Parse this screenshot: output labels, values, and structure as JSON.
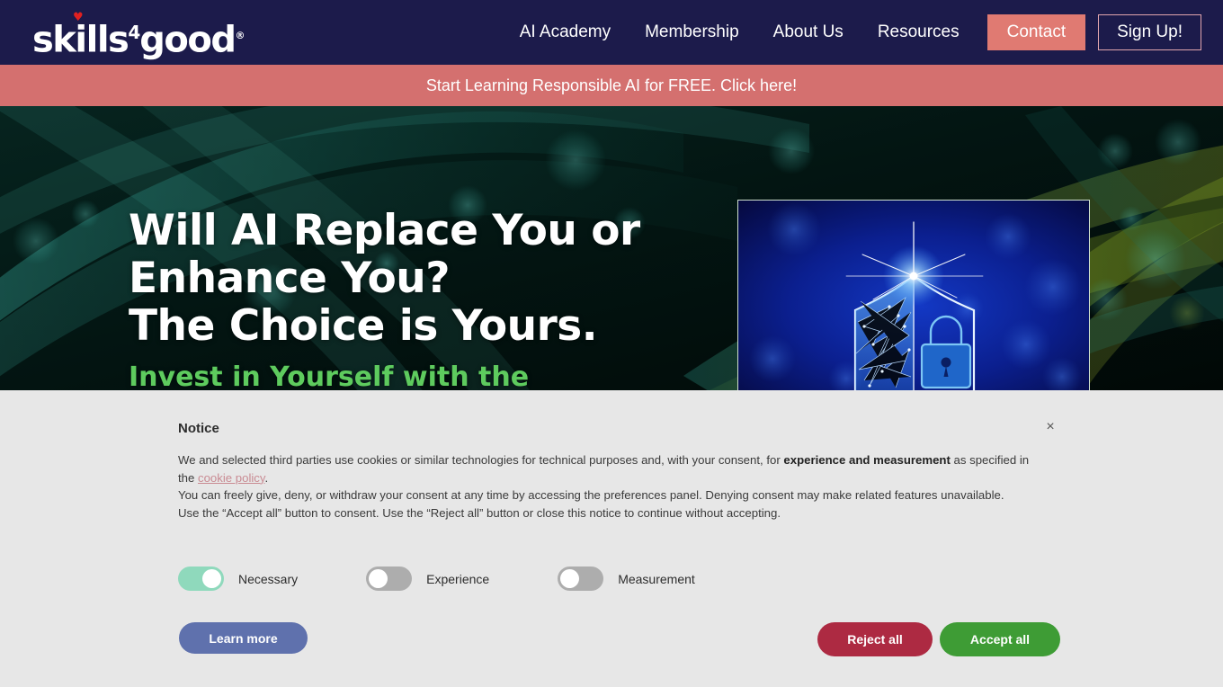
{
  "header": {
    "logo": {
      "text_before": "skills",
      "sup": "4",
      "text_after": "good",
      "registered": "®",
      "heart_icon": "heart-icon"
    },
    "nav": [
      {
        "label": "AI Academy",
        "name": "nav-link-ai-academy"
      },
      {
        "label": "Membership",
        "name": "nav-link-membership"
      },
      {
        "label": "About Us",
        "name": "nav-link-about-us"
      },
      {
        "label": "Resources",
        "name": "nav-link-resources"
      }
    ],
    "contact_button": "Contact",
    "signup_button": "Sign Up!",
    "background_color": "#1c1b4b",
    "contact_color": "#e07a72"
  },
  "promo": {
    "text": "Start Learning Responsible AI for FREE. Click here!",
    "background_color": "#d4706f"
  },
  "hero": {
    "title_line1": "Will AI Replace You or",
    "title_line2": "Enhance You?",
    "title_line3": "The Choice is Yours.",
    "subtitle": "Invest in Yourself with the",
    "subtitle_color": "#5ecb5e",
    "image_alt": "shield-lock-network-image"
  },
  "notice": {
    "title": "Notice",
    "close_label": "×",
    "paragraph1_a": "We and selected third parties use cookies or similar technologies for technical purposes and, with your consent, for ",
    "paragraph1_bold": "experience and measurement",
    "paragraph1_b": " as specified in the ",
    "link_text": "cookie policy",
    "paragraph1_c": ".",
    "paragraph2": "You can freely give, deny, or withdraw your consent at any time by accessing the preferences panel. Denying consent may make related features unavailable.",
    "paragraph3": "Use the “Accept all” button to consent. Use the “Reject all” button or close this notice to continue without accepting.",
    "link_color": "#c98b93",
    "background_color": "#e7e7e7",
    "toggles": [
      {
        "label": "Necessary",
        "state": "on",
        "name": "toggle-necessary"
      },
      {
        "label": "Experience",
        "state": "off",
        "name": "toggle-experience"
      },
      {
        "label": "Measurement",
        "state": "off",
        "name": "toggle-measurement"
      }
    ],
    "buttons": {
      "learn_more": "Learn more",
      "reject_all": "Reject all",
      "accept_all": "Accept all",
      "learn_more_color": "#5f71ad",
      "reject_all_color": "#ad2a42",
      "accept_all_color": "#3e9c35"
    }
  }
}
